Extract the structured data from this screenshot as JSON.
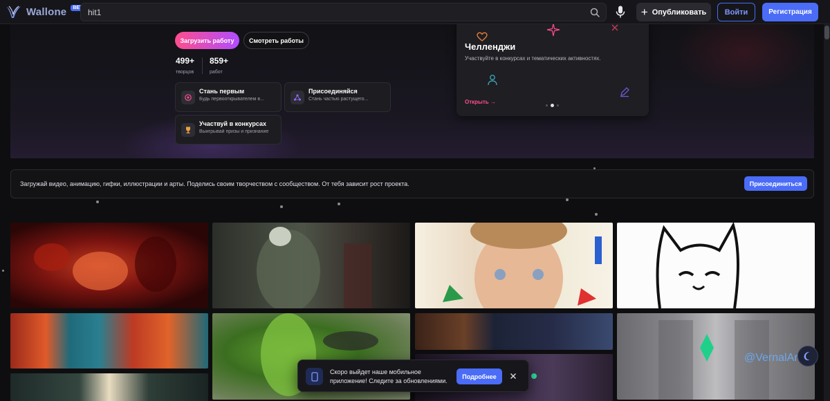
{
  "header": {
    "logo_text": "Wallone",
    "beta_badge": "BETA",
    "search_value": "hit1",
    "publish_label": "Опубликовать",
    "login_label": "Войти",
    "register_label": "Регистрация"
  },
  "hero": {
    "upload_label": "Загрузить работу",
    "view_label": "Смотреть работы",
    "stats": [
      {
        "value": "499+",
        "label": "творцов"
      },
      {
        "value": "859+",
        "label": "работ"
      }
    ],
    "features": [
      {
        "title": "Стань первым",
        "desc": "Будь первооткрывателем в...",
        "icon": "badge-icon",
        "color": "#ff4d8d"
      },
      {
        "title": "Присоединяйся",
        "desc": "Стань частью растущего...",
        "icon": "network-icon",
        "color": "#9a6cff"
      },
      {
        "title": "Участвуй в конкурсах",
        "desc": "Выигрывай призы и признание",
        "icon": "trophy-icon",
        "color": "#f0a040"
      }
    ]
  },
  "challenge": {
    "title": "Челленджи",
    "desc": "Участвуйте в конкурсах и тематических активностях.",
    "open_label": "Открыть",
    "arrow": "→",
    "dots": 3,
    "active_dot": 1
  },
  "banner": {
    "text": "Загружай видео, анимацию, гифки, иллюстрации и арты. Поделись своим творчеством с сообществом. От тебя зависит рост проекта.",
    "join_label": "Присоединиться"
  },
  "gallery": {
    "watermark": "@VernalAr"
  },
  "toast": {
    "text": "Скоро выйдет наше мобильное приложение! Следите за обновлениями.",
    "more_label": "Подробнее"
  },
  "colors": {
    "accent": "#4a6cf7",
    "pink": "#ff4d8d",
    "background": "#0e0e10"
  }
}
